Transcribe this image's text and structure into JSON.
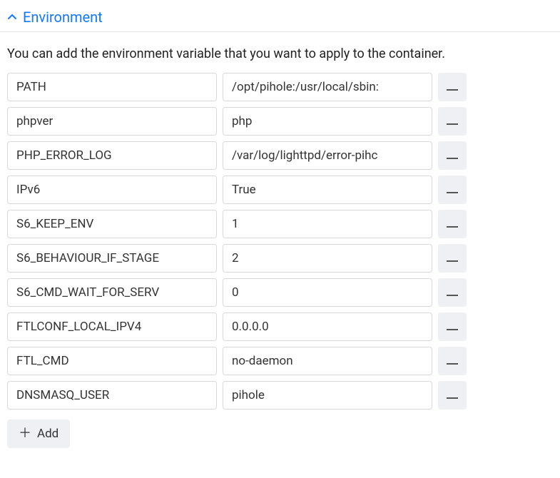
{
  "section": {
    "title": "Environment",
    "description": "You can add the environment variable that you want to apply to the container."
  },
  "env_vars": [
    {
      "key": "PATH",
      "value": "/opt/pihole:/usr/local/sbin:"
    },
    {
      "key": "phpver",
      "value": "php"
    },
    {
      "key": "PHP_ERROR_LOG",
      "value": "/var/log/lighttpd/error-pihc"
    },
    {
      "key": "IPv6",
      "value": "True"
    },
    {
      "key": "S6_KEEP_ENV",
      "value": "1"
    },
    {
      "key": "S6_BEHAVIOUR_IF_STAGE",
      "value": "2"
    },
    {
      "key": "S6_CMD_WAIT_FOR_SERV",
      "value": "0"
    },
    {
      "key": "FTLCONF_LOCAL_IPV4",
      "value": "0.0.0.0"
    },
    {
      "key": "FTL_CMD",
      "value": "no-daemon"
    },
    {
      "key": "DNSMASQ_USER",
      "value": "pihole"
    }
  ],
  "buttons": {
    "add_label": "Add"
  }
}
